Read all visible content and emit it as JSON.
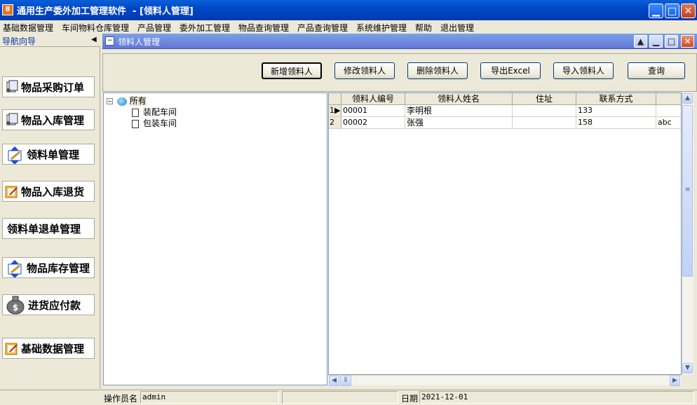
{
  "window": {
    "title": "通用生产委外加工管理软件  - [领料人管理]"
  },
  "menu": [
    "基础数据管理",
    "车间物料仓库管理",
    "产品管理",
    "委外加工管理",
    "物品查询管理",
    "产品查询管理",
    "系统维护管理",
    "帮助",
    "退出管理"
  ],
  "nav": {
    "title": "导航向导",
    "items": [
      {
        "label": "物品采购订单",
        "icon": "document-icon"
      },
      {
        "label": "物品入库管理",
        "icon": "document-icon"
      },
      {
        "label": "领料单管理",
        "icon": "edit-arrows-icon"
      },
      {
        "label": "物品入库退货",
        "icon": "folder-edit-icon"
      },
      {
        "label": "领料单退单管理",
        "icon": ""
      },
      {
        "label": "物品库存管理",
        "icon": "edit-arrows-icon"
      },
      {
        "label": "进货应付款",
        "icon": "money-bag-icon"
      },
      {
        "label": "基础数据管理",
        "icon": "folder-edit-icon"
      }
    ]
  },
  "inner": {
    "title": "领料人管理"
  },
  "toolbar": {
    "add": "新增领料人",
    "edit": "修改领料人",
    "delete": "删除领料人",
    "export": "导出Excel",
    "import": "导入领料人",
    "query": "查询"
  },
  "tree": {
    "root": "所有",
    "children": [
      "装配车间",
      "包装车间"
    ]
  },
  "grid": {
    "columns": [
      "领料人编号",
      "领料人姓名",
      "住址",
      "联系方式",
      ""
    ],
    "rows": [
      {
        "num": "1",
        "cells": [
          "00001",
          "李明根",
          "",
          "133",
          ""
        ]
      },
      {
        "num": "2",
        "cells": [
          "00002",
          "张强",
          "",
          "158",
          "abc"
        ]
      }
    ]
  },
  "status": {
    "operator_label": "操作员名",
    "operator": "admin",
    "date_label": "日期",
    "date": "2021-12-01"
  }
}
